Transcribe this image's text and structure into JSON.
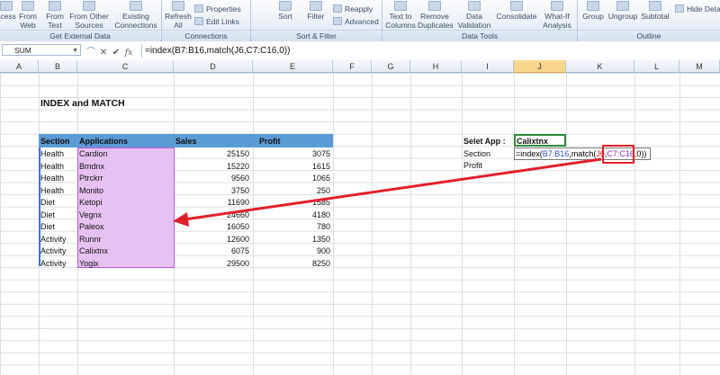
{
  "ribbon": {
    "buttons": [
      {
        "label": "ccess",
        "x": "ribbon-access"
      },
      {
        "label": "From Web"
      },
      {
        "label": "From Text"
      },
      {
        "label": "From Other Sources"
      },
      {
        "label": "Existing Connections"
      },
      {
        "label": "Refresh All"
      },
      {
        "label": "Sort"
      },
      {
        "label": "Filter"
      },
      {
        "label": "Text to Columns"
      },
      {
        "label": "Remove Duplicates"
      },
      {
        "label": "Data Validation"
      },
      {
        "label": "Consolidate"
      },
      {
        "label": "What-If Analysis"
      },
      {
        "label": "Group"
      },
      {
        "label": "Ungroup"
      },
      {
        "label": "Subtotal"
      }
    ],
    "small": {
      "properties": "Properties",
      "edit_links": "Edit Links",
      "reapply": "Reapply",
      "advanced": "Advanced",
      "hide_detail": "Hide Detail"
    },
    "groups": {
      "get_external": "Get External Data",
      "connections": "Connections",
      "sort_filter": "Sort & Filter",
      "data_tools": "Data Tools",
      "outline": "Outline"
    }
  },
  "formula_bar": {
    "name_box": "SUM",
    "cancel_icon": "✕",
    "enter_icon": "✔",
    "fx_label": "fx",
    "formula": "=index(B7:B16,match(J6,C7:C16,0))"
  },
  "columns": [
    "A",
    "B",
    "C",
    "D",
    "E",
    "F",
    "G",
    "H",
    "I",
    "J",
    "K",
    "L",
    "M"
  ],
  "sheet": {
    "title": "INDEX and MATCH",
    "headers": {
      "section": "Section",
      "applications": "Applications",
      "sales": "Sales",
      "profit": "Profit"
    },
    "rows": [
      {
        "section": "Health",
        "app": "Cardion",
        "sales": "25150",
        "profit": "3075"
      },
      {
        "section": "Health",
        "app": "Bmdnx",
        "sales": "15220",
        "profit": "1615"
      },
      {
        "section": "Health",
        "app": "Ptrckrr",
        "sales": "9560",
        "profit": "1065"
      },
      {
        "section": "Health",
        "app": "Monito",
        "sales": "3750",
        "profit": "250"
      },
      {
        "section": "Diet",
        "app": "Ketopi",
        "sales": "11690",
        "profit": "1585"
      },
      {
        "section": "Diet",
        "app": "Vegnx",
        "sales": "24660",
        "profit": "4180"
      },
      {
        "section": "Diet",
        "app": "Paleox",
        "sales": "16050",
        "profit": "780"
      },
      {
        "section": "Activity",
        "app": "Runnr",
        "sales": "12600",
        "profit": "1350"
      },
      {
        "section": "Activity",
        "app": "Calixtnx",
        "sales": "6075",
        "profit": "900"
      },
      {
        "section": "Activity",
        "app": "Yogix",
        "sales": "29500",
        "profit": "8250"
      }
    ],
    "lookup": {
      "select_label": "Selet App :",
      "select_value": "Calixtnx",
      "section_label": "Section",
      "profit_label": "Profit",
      "edit_parts": [
        "=index(",
        "B7:B16",
        ",match(",
        "J6",
        ",",
        "C7:C16",
        ",0))"
      ]
    }
  },
  "colors": {
    "header_band": "#5b9bd5",
    "highlight": "#e8c1f3",
    "arrow": "#e0202a",
    "selected_cell_border": "#2e8b3a"
  }
}
